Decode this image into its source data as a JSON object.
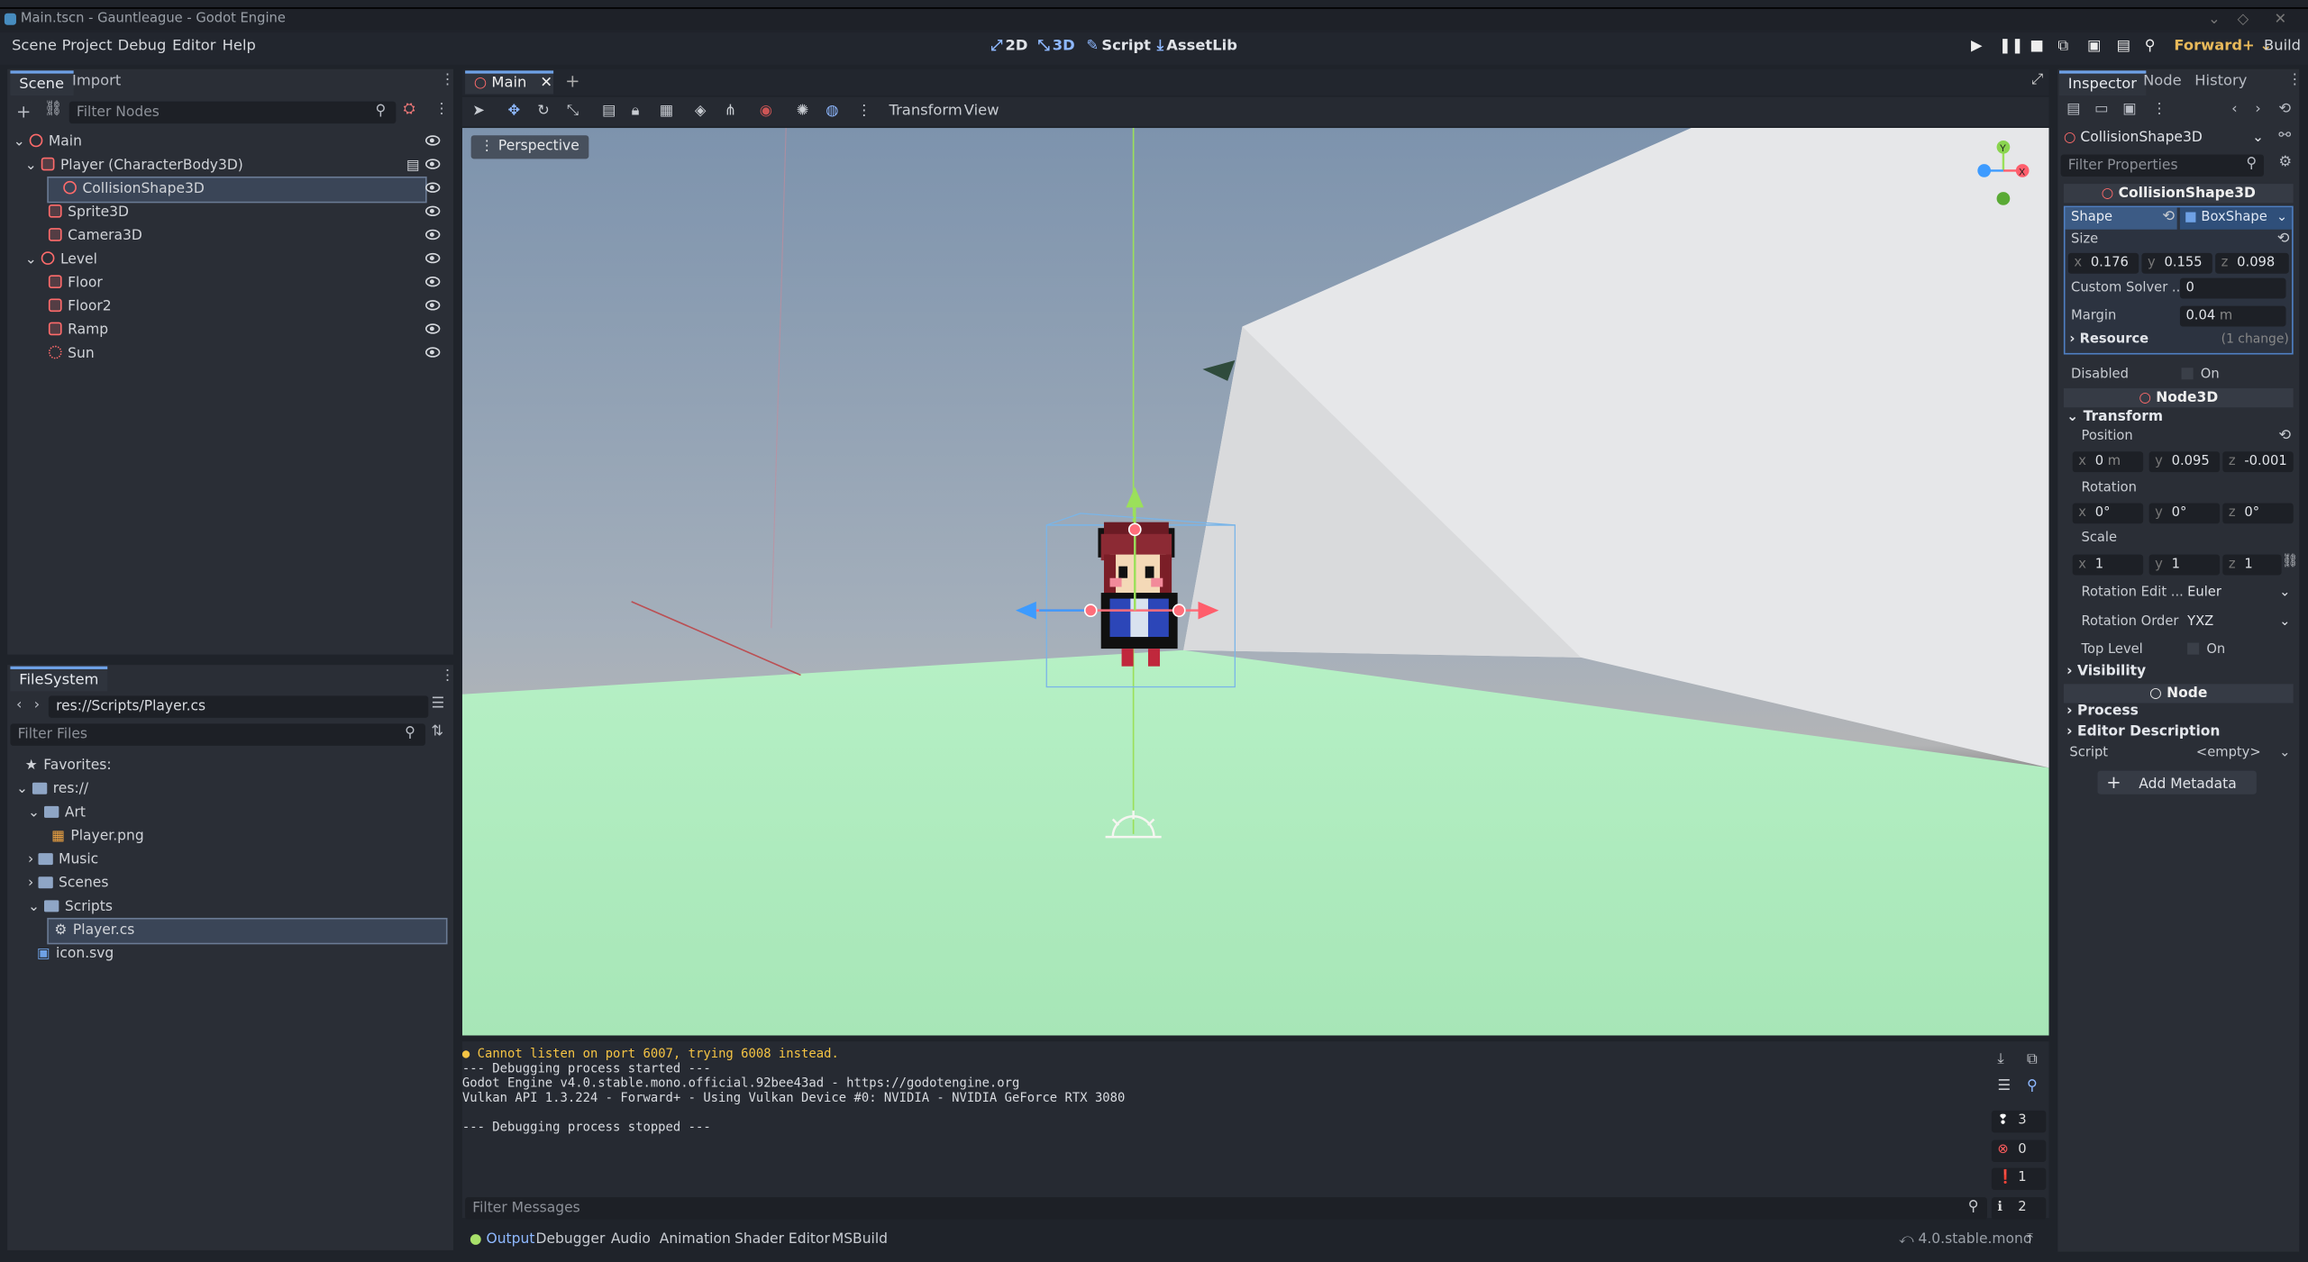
{
  "window": {
    "title": "Main.tscn - Gauntleague - Godot Engine"
  },
  "menu": {
    "items": [
      "Scene",
      "Project",
      "Debug",
      "Editor",
      "Help"
    ]
  },
  "workspaces": [
    "2D",
    "3D",
    "Script",
    "AssetLib"
  ],
  "renderer": "Forward+",
  "build_label": "Build",
  "scene_dock": {
    "tabs": [
      "Scene",
      "Import"
    ],
    "filter_placeholder": "Filter Nodes",
    "nodes": [
      "Main",
      "Player (CharacterBody3D)",
      "CollisionShape3D",
      "Sprite3D",
      "Camera3D",
      "Level",
      "Floor",
      "Floor2",
      "Ramp",
      "Sun"
    ]
  },
  "filesystem": {
    "tab": "FileSystem",
    "path": "res://Scripts/Player.cs",
    "filter_placeholder": "Filter Files",
    "items": [
      "Favorites:",
      "res://",
      "Art",
      "Player.png",
      "Music",
      "Scenes",
      "Scripts",
      "Player.cs",
      "icon.svg"
    ]
  },
  "editor": {
    "scene_tab": "Main",
    "toolbar": {
      "transform": "Transform",
      "view": "View"
    },
    "perspective": "Perspective",
    "gizmo": {
      "y": "Y",
      "x": "X"
    }
  },
  "console": {
    "lines": [
      "Cannot listen on port 6007, trying 6008 instead.",
      "--- Debugging process started ---",
      "Godot Engine v4.0.stable.mono.official.92bee43ad - https://godotengine.org",
      "Vulkan API 1.3.224 - Forward+ - Using Vulkan Device #0: NVIDIA - NVIDIA GeForce RTX 3080",
      "",
      "--- Debugging process stopped ---"
    ],
    "filter_placeholder": "Filter Messages",
    "counts": [
      "3",
      "0",
      "1",
      "2"
    ],
    "status_color_warning": "#f5c444",
    "status_color_error": "#ff5d5d"
  },
  "bottom_tabs": [
    "Output",
    "Debugger",
    "Audio",
    "Animation",
    "Shader Editor",
    "MSBuild"
  ],
  "version": "4.0.stable.mono",
  "inspector": {
    "tabs": [
      "Inspector",
      "Node",
      "History"
    ],
    "object": "CollisionShape3D",
    "filter_placeholder": "Filter Properties",
    "section_collision": "CollisionShape3D",
    "shape_label": "Shape",
    "shape_value": "BoxShape",
    "size_label": "Size",
    "size": {
      "x": "0.176",
      "y": "0.155",
      "z": "0.098"
    },
    "custom_solver_label": "Custom Solver ...",
    "custom_solver_value": "0",
    "margin_label": "Margin",
    "margin_value": "0.04",
    "margin_unit": "m",
    "resource_label": "Resource",
    "resource_changes": "(1 change)",
    "disabled_label": "Disabled",
    "on_label": "On",
    "section_node3d": "Node3D",
    "transform_label": "Transform",
    "position_label": "Position",
    "position": {
      "x": "0",
      "x_unit": "m",
      "y": "0.095",
      "z": "-0.001"
    },
    "rotation_label": "Rotation",
    "rotation": {
      "x": "0",
      "y": "0",
      "z": "0",
      "unit": "°"
    },
    "scale_label": "Scale",
    "scale": {
      "x": "1",
      "y": "1",
      "z": "1"
    },
    "rotation_edit_label": "Rotation Edit ...",
    "rotation_edit_value": "Euler",
    "rotation_order_label": "Rotation Order",
    "rotation_order_value": "YXZ",
    "top_level_label": "Top Level",
    "visibility_label": "Visibility",
    "section_node": "Node",
    "process_label": "Process",
    "editor_description_label": "Editor Description",
    "script_label": "Script",
    "script_value": "<empty>",
    "add_metadata_label": "Add Metadata"
  }
}
